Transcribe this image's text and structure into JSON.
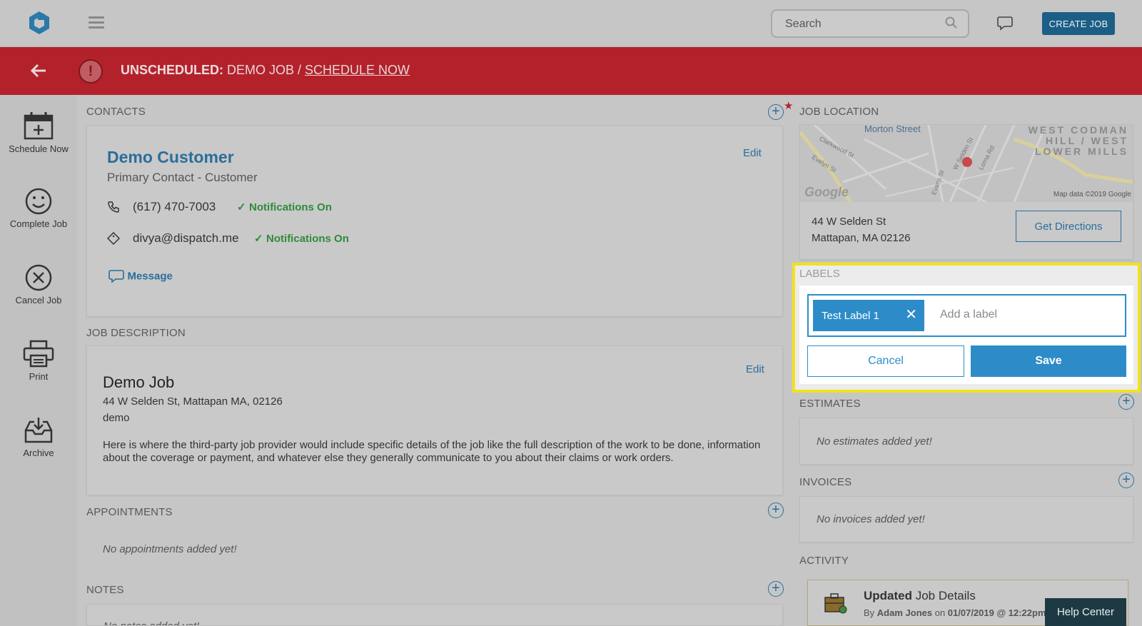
{
  "header": {
    "search_placeholder": "Search",
    "create_job": "CREATE JOB"
  },
  "banner": {
    "status": "UNSCHEDULED:",
    "job": " DEMO JOB / ",
    "action": "SCHEDULE NOW"
  },
  "sidebar": {
    "items": [
      {
        "label": "Schedule Now"
      },
      {
        "label": "Complete Job"
      },
      {
        "label": "Cancel Job"
      },
      {
        "label": "Print"
      },
      {
        "label": "Archive"
      }
    ]
  },
  "contacts": {
    "heading": "CONTACTS",
    "name": "Demo Customer",
    "role": "Primary Contact - Customer",
    "edit": "Edit",
    "phone": "(617) 470-7003",
    "phone_notif": "Notifications On",
    "email": "divya@dispatch.me",
    "email_notif": "Notifications On",
    "message": "Message"
  },
  "job_description": {
    "heading": "JOB DESCRIPTION",
    "edit": "Edit",
    "title": "Demo Job",
    "address": "44 W Selden St, Mattapan MA, 02126",
    "tag": "demo",
    "body": "Here is where the third-party job provider would include specific details of the job like the full description of the work to be done, information about the coverage or payment, and whatever else they generally communicate to you about their claims or work orders."
  },
  "appointments": {
    "heading": "APPOINTMENTS",
    "empty": "No appointments added yet!"
  },
  "notes": {
    "heading": "NOTES",
    "empty": "No notes added yet!"
  },
  "job_location": {
    "heading": "JOB LOCATION",
    "map_street": "Morton Street",
    "map_area_1": "WEST CODMAN",
    "map_area_2": "HILL / WEST",
    "map_area_3": "LOWER MILLS",
    "map_road_1": "Clarkwood St",
    "map_road_2": "Evelyn St",
    "map_road_3": "W Selden St",
    "map_road_4": "Evans St",
    "map_road_5": "Lorna Rd",
    "map_brand": "Google",
    "map_credit": "Map data ©2019 Google",
    "address_line1": "44 W Selden St",
    "address_line2": "Mattapan, MA 02126",
    "directions": "Get Directions"
  },
  "labels": {
    "heading": "LABELS",
    "chip": "Test Label 1",
    "placeholder": "Add a label",
    "cancel": "Cancel",
    "save": "Save"
  },
  "estimates": {
    "heading": "ESTIMATES",
    "empty": "No estimates added yet!"
  },
  "invoices": {
    "heading": "INVOICES",
    "empty": "No invoices added yet!"
  },
  "activity": {
    "heading": "ACTIVITY",
    "title_bold": "Updated",
    "title_rest": " Job Details",
    "by_prefix": "By ",
    "by_user": "Adam Jones",
    "on": " on ",
    "timestamp": "01/07/2019 @ 12:22pm"
  },
  "help_center": "Help Center",
  "colors": {
    "brand_blue": "#2d8cc8",
    "banner_red": "#b3222b",
    "highlight_yellow": "#f2e21d",
    "notif_green": "#2e8b3a"
  }
}
